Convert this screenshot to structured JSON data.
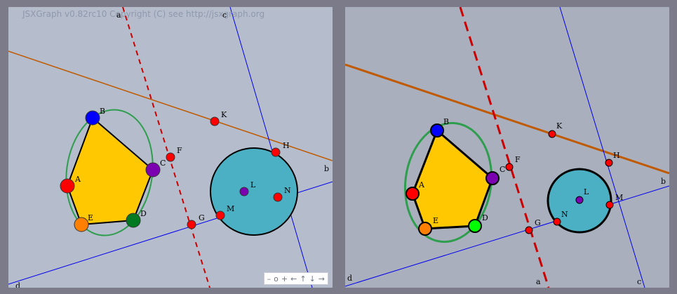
{
  "left_board": {
    "copyright": "JSXGraph v0.82rc10 Copyright (C) see http://jsxgraph.org",
    "labels": {
      "a": "a",
      "c": "c",
      "b": "b",
      "d": "d",
      "A": "A",
      "B": "B",
      "C": "C",
      "D": "D",
      "E": "E",
      "F": "F",
      "G": "G",
      "H": "H",
      "K": "K",
      "L": "L",
      "M": "M",
      "N": "N"
    },
    "navbar": {
      "zoom_out": "–",
      "zoom_reset": "o",
      "zoom_in": "+",
      "left": "←",
      "up": "↑",
      "down": "↓",
      "right": "→"
    }
  },
  "right_board": {
    "labels": {
      "a": "a",
      "c": "c",
      "b": "b",
      "d": "d",
      "A": "A",
      "B": "B",
      "C": "C",
      "D": "D",
      "E": "E",
      "F": "F",
      "G": "G",
      "H": "H",
      "K": "K",
      "L": "L",
      "M": "M",
      "N": "N"
    }
  },
  "colors": {
    "point_A": "#ff0000",
    "point_B": "#0000ff",
    "point_C": "#7a00b0",
    "point_D_left": "#007a20",
    "point_D_right": "#00ff00",
    "point_E": "#ff7f00",
    "point_red": "#ff0000",
    "polygon": "#ffc800",
    "ellipse": "#2e9e4e",
    "circle_fill": "#4bb0c4",
    "line_b": "#c05a00",
    "line_a": "#cc0000",
    "line_blue": "#0000ee"
  }
}
